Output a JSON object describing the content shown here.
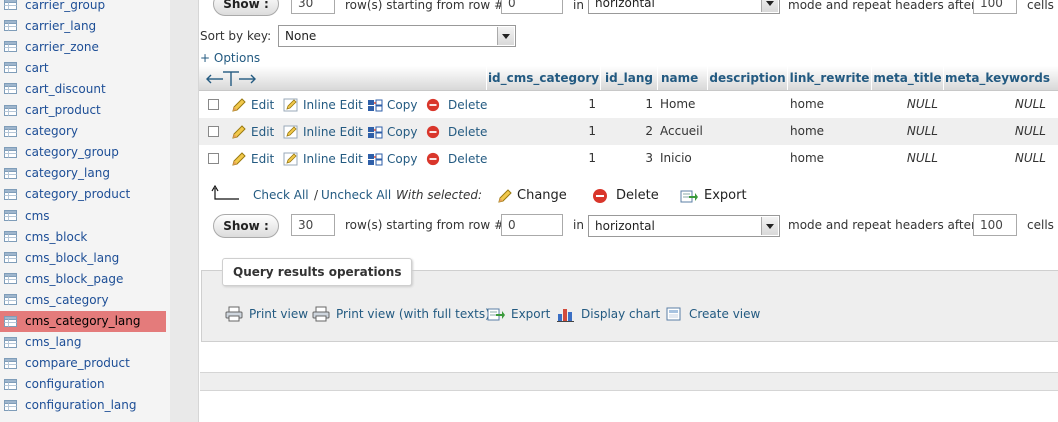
{
  "sidebar": {
    "items": [
      {
        "label": "carrier_group"
      },
      {
        "label": "carrier_lang"
      },
      {
        "label": "carrier_zone"
      },
      {
        "label": "cart"
      },
      {
        "label": "cart_discount"
      },
      {
        "label": "cart_product"
      },
      {
        "label": "category"
      },
      {
        "label": "category_group"
      },
      {
        "label": "category_lang"
      },
      {
        "label": "category_product"
      },
      {
        "label": "cms"
      },
      {
        "label": "cms_block"
      },
      {
        "label": "cms_block_lang"
      },
      {
        "label": "cms_block_page"
      },
      {
        "label": "cms_category"
      },
      {
        "label": "cms_category_lang",
        "active": true
      },
      {
        "label": "cms_lang"
      },
      {
        "label": "compare_product"
      },
      {
        "label": "configuration"
      },
      {
        "label": "configuration_lang"
      }
    ],
    "icon": "table-icon"
  },
  "nav_top": {
    "show_label": "Show :",
    "rows_value": "30",
    "rows_label": "row(s) starting from row #",
    "start_value": "0",
    "in_label": "in",
    "mode_value": "horizontal",
    "repeat_label": "mode and repeat headers after",
    "repeat_value": "100",
    "cells_label": "cells"
  },
  "sort": {
    "label": "Sort by key:",
    "value": "None"
  },
  "options_link": "+ Options",
  "table": {
    "columns": [
      "id_cms_category",
      "id_lang",
      "name",
      "description",
      "link_rewrite",
      "meta_title",
      "meta_keywords"
    ],
    "rows": [
      {
        "id_cms_category": "1",
        "id_lang": "1",
        "name": "Home",
        "description": "",
        "link_rewrite": "home",
        "meta_title": "NULL",
        "meta_keywords": "NULL"
      },
      {
        "id_cms_category": "1",
        "id_lang": "2",
        "name": "Accueil",
        "description": "",
        "link_rewrite": "home",
        "meta_title": "NULL",
        "meta_keywords": "NULL"
      },
      {
        "id_cms_category": "1",
        "id_lang": "3",
        "name": "Inicio",
        "description": "",
        "link_rewrite": "home",
        "meta_title": "NULL",
        "meta_keywords": "NULL"
      }
    ],
    "actions": {
      "edit": "Edit",
      "inline_edit": "Inline Edit",
      "copy": "Copy",
      "delete": "Delete"
    }
  },
  "bulk": {
    "check_all": "Check All",
    "separator": "/",
    "uncheck_all": "Uncheck All",
    "with_selected": "With selected:",
    "change": "Change",
    "delete": "Delete",
    "export": "Export"
  },
  "nav_bottom": {
    "show_label": "Show :",
    "rows_value": "30",
    "rows_label": "row(s) starting from row #",
    "start_value": "0",
    "in_label": "in",
    "mode_value": "horizontal",
    "repeat_label": "mode and repeat headers after",
    "repeat_value": "100",
    "cells_label": "cells"
  },
  "query_ops": {
    "title": "Query results operations",
    "print_view": "Print view",
    "print_view_full": "Print view (with full texts)",
    "export": "Export",
    "display_chart": "Display chart",
    "create_view": "Create view"
  },
  "colors": {
    "link": "#235a81",
    "active_row": "#e47b7b",
    "delete_red": "#d9362b",
    "edit_yellow": "#e8b530"
  }
}
